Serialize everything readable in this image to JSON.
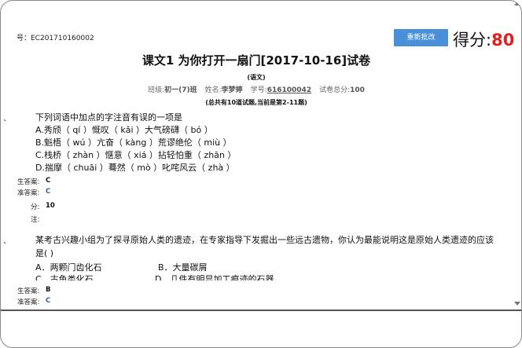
{
  "header": {
    "paper_number": "号：EC201710160002",
    "regrade_button": "重新批改",
    "score_label": "得分:",
    "score_value": "80"
  },
  "title": "课文1 为你打开一扇门[2017-10-16]试卷",
  "subject": "(语文)",
  "info": {
    "class_label": "班级:",
    "class_value": "初一(7)班",
    "name_label": "姓名:",
    "name_value": "李梦婷",
    "id_label": "学号:",
    "id_value": "616100042",
    "total_label": "试卷总分:",
    "total_value": "100"
  },
  "counts": "(总共有10道试题,当前是第2-11题)",
  "questions": [
    {
      "bullet": "、",
      "text": "下列词语中加点的字注音有误的一项是",
      "options": [
        "A.秀颀（ qí ）慨叹（ kǎi ）大气磅礴（ bó ）",
        "B.魁梧（ wú ）亢奋（ kàng ）荒谬绝伦（ miù ）",
        "C.栈桥（ zhàn ）惬意（ xiá ）拈轻怕重（ zhān ）",
        "D.揣摩（ chuāi ）蓦然（ mò ）叱咤风云（ zhà ）"
      ],
      "student_answer_label": "生答案:",
      "student_answer": "C",
      "correct_answer_label": "准答案:",
      "correct_answer": "C",
      "score_label": "分:",
      "score": "10",
      "note_label": "注:"
    },
    {
      "bullet": "、",
      "text": "某考古兴趣小组为了探寻原始人类的遗迹，在专家指导下发掘出一些远古遗物，你认为最能说明这是原始人类遗迹的应该",
      "text_line2": "是(   )",
      "options": [
        "A．两颗门齿化石",
        "B．大量碳屑",
        "C．古鱼类化石",
        "D．几件有明显加工痕迹的石器"
      ],
      "student_answer_label": "生答案:",
      "student_answer": "B",
      "correct_answer_label": "准答案:",
      "correct_answer": "C"
    }
  ]
}
